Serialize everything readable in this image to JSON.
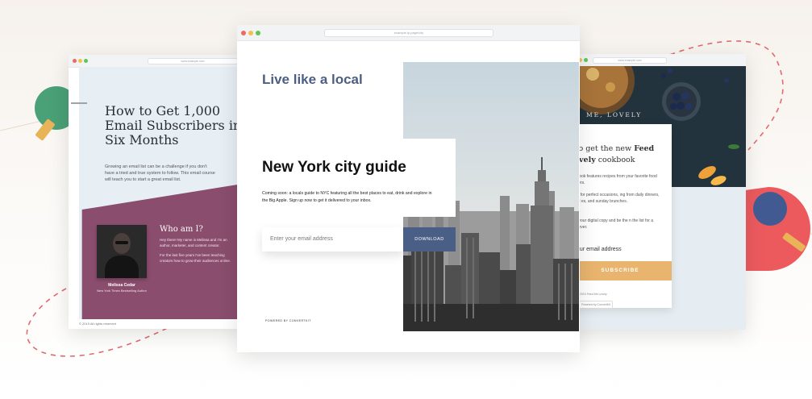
{
  "colors": {
    "accent_blue": "#4a5f86",
    "plum": "#8a4d6d",
    "subscribe_orange": "#e9b46d",
    "dash_red": "#e16a6e",
    "green_circle": "#4aa077",
    "red_circle": "#ec5a5e",
    "navy_circle": "#415a92",
    "gold_bar": "#e9b457"
  },
  "left_window": {
    "url": "www.example.com",
    "title": "How to Get 1,000 Email Subscribers in Six Months",
    "description": "Growing an email list can be a challenge if you don't have a tried and true system to follow. This email course will teach you to start a great email list.",
    "who_title": "Who am I?",
    "who_text_1": "Hey there! My name is Melissa and I'm an author, marketer, and content creator.",
    "who_text_2": "For the last five years I've been teaching creators how to grow their audiences online.",
    "author_name": "Melissa Cedar",
    "author_sub": "New York Times Bestselling Author",
    "footer": "© 2019 All rights reserved",
    "icon": "portrait-photo-icon"
  },
  "center_window": {
    "url": "example.lp.page/city",
    "headline": "Live like a local",
    "guide_title": "New York city guide",
    "guide_desc": "Coming soon: a locals guide to NYC featuring all the best places to eat, drink and explore in the Big Apple. Sign up now to get it delivered to your inbox.",
    "email_placeholder": "Enter your email address",
    "download_label": "DOWNLOAD",
    "powered_by": "POWERED BY CONVERTKIT",
    "icon": "city-skyline-photo-icon"
  },
  "right_window": {
    "url": "www.example.com",
    "brand_partial": "ME, LOVELY",
    "title_prefix": "e to get the new ",
    "title_bold_1": "Feed",
    "title_bold_2": "Lovely",
    "title_suffix": " cookbook",
    "p1": "cookbook features recipes from your favorite food bloggers.",
    "p2": "meals for perfect occasions, ing from daily dinners, casual es, and sunday brunches.",
    "p3": "o get your digital copy and be the n the list for a hardcover.",
    "email_label": "Your email address",
    "subscribe_label": "SUBSCRIBE",
    "copyright": "© 2019 Feed Me Lovely",
    "powered_by": "Powered by ConvertKit",
    "icon": "food-bowl-photo-icon"
  }
}
